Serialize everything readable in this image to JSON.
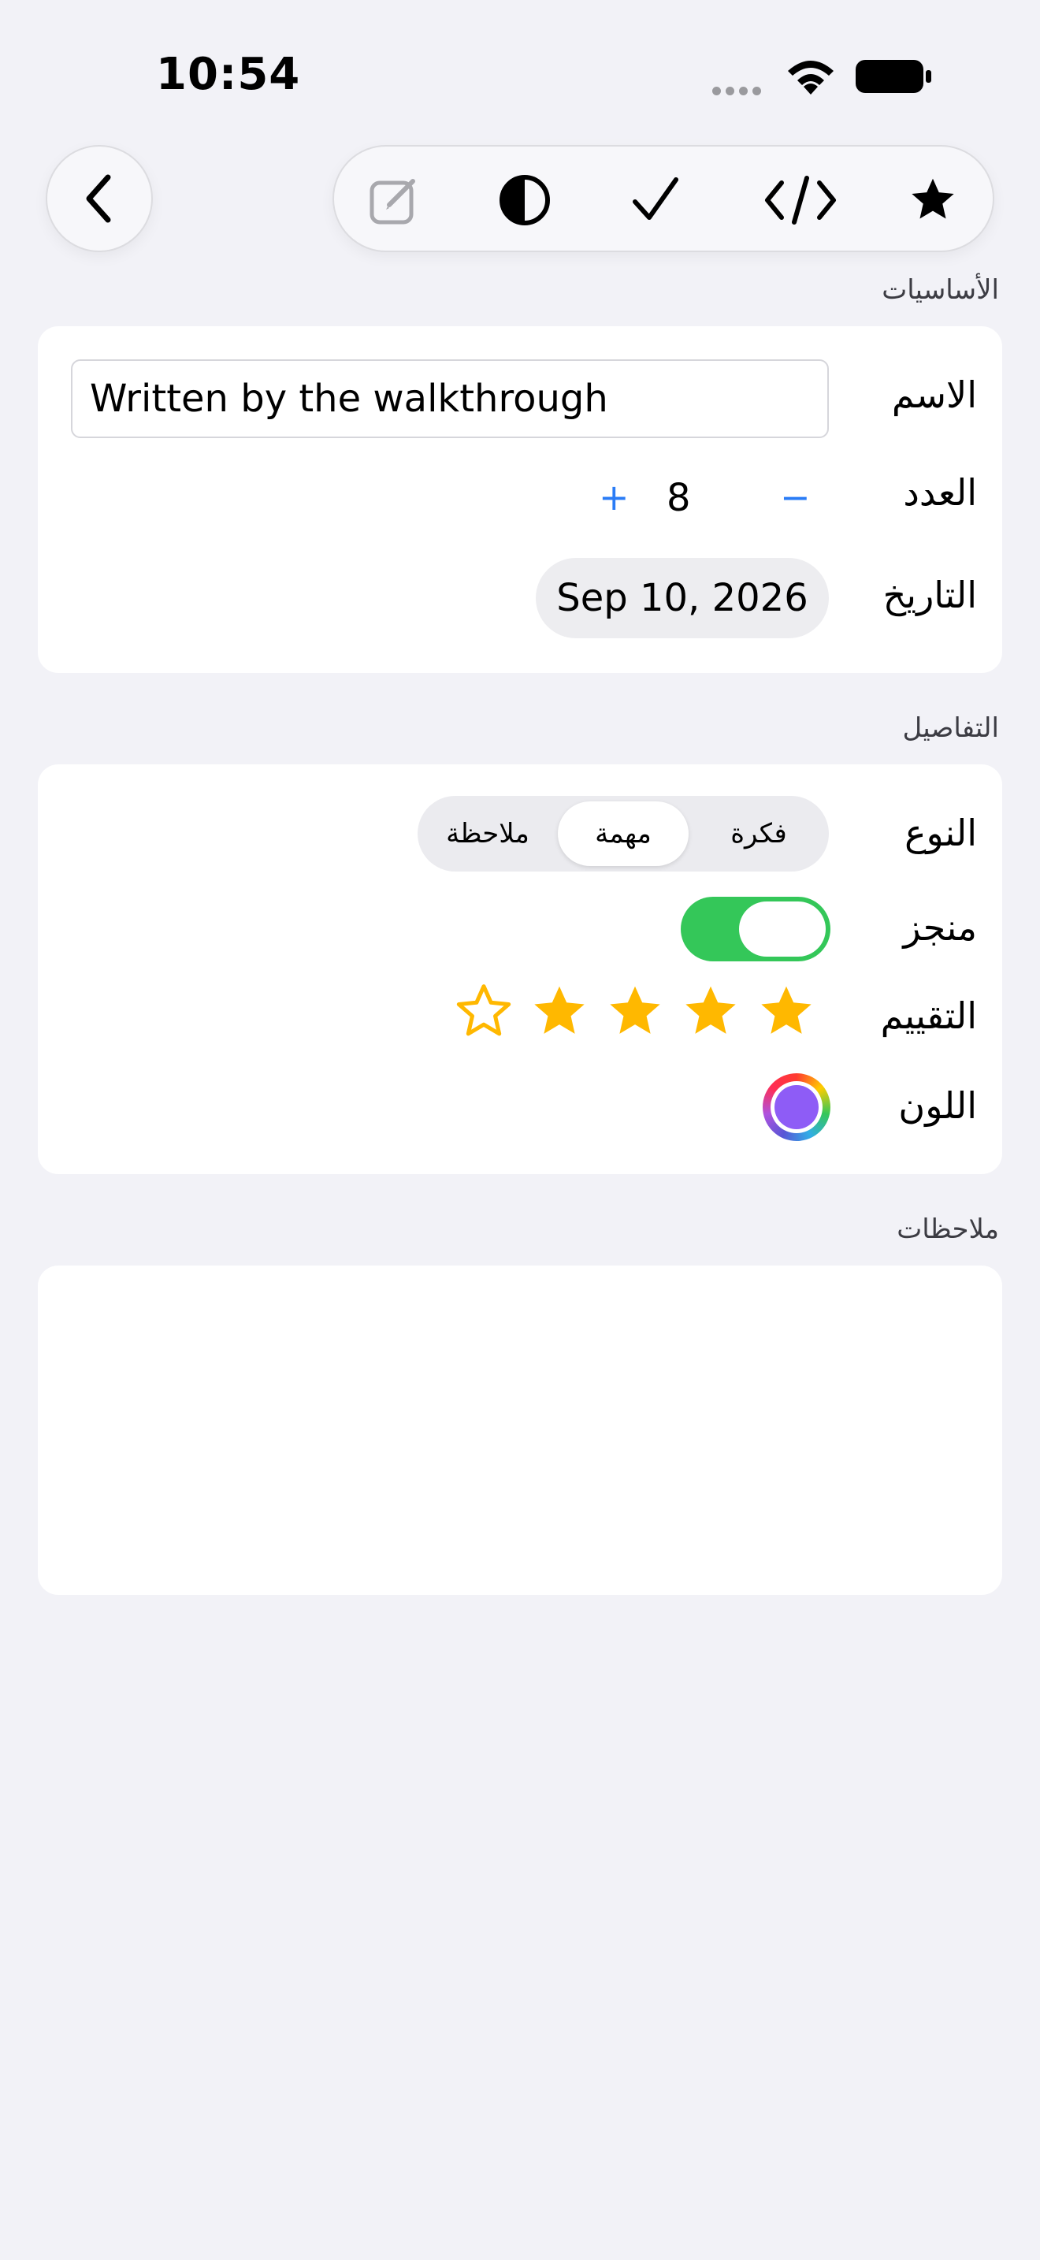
{
  "status_bar": {
    "time": "10:54"
  },
  "toolbar": {
    "back_icon": "chevron-left-icon",
    "icons": [
      "compose-icon",
      "contrast-icon",
      "checkmark-icon",
      "code-icon",
      "star-icon"
    ]
  },
  "sections": {
    "basics": {
      "title": "الأساسيات",
      "name_label": "الاسم",
      "name_value": "Written by the walkthrough",
      "count_label": "العدد",
      "count_value": "8",
      "count_plus": "+",
      "count_minus": "−",
      "date_label": "التاريخ",
      "date_value": "Sep 10, 2026"
    },
    "details": {
      "title": "التفاصيل",
      "type_label": "النوع",
      "type_options": [
        "فكرة",
        "مهمة",
        "ملاحظة"
      ],
      "type_selected": "مهمة",
      "done_label": "منجز",
      "done_on": true,
      "rating_label": "التقييم",
      "rating": 4,
      "rating_max": 5,
      "color_label": "اللون",
      "color_value": "#8E5CF6"
    },
    "notes": {
      "title": "ملاحظات",
      "text": ""
    }
  },
  "colors": {
    "accent": "#2A7CF6",
    "toggle_on": "#34C759",
    "star": "#FFB800",
    "background": "#F2F2F7"
  }
}
